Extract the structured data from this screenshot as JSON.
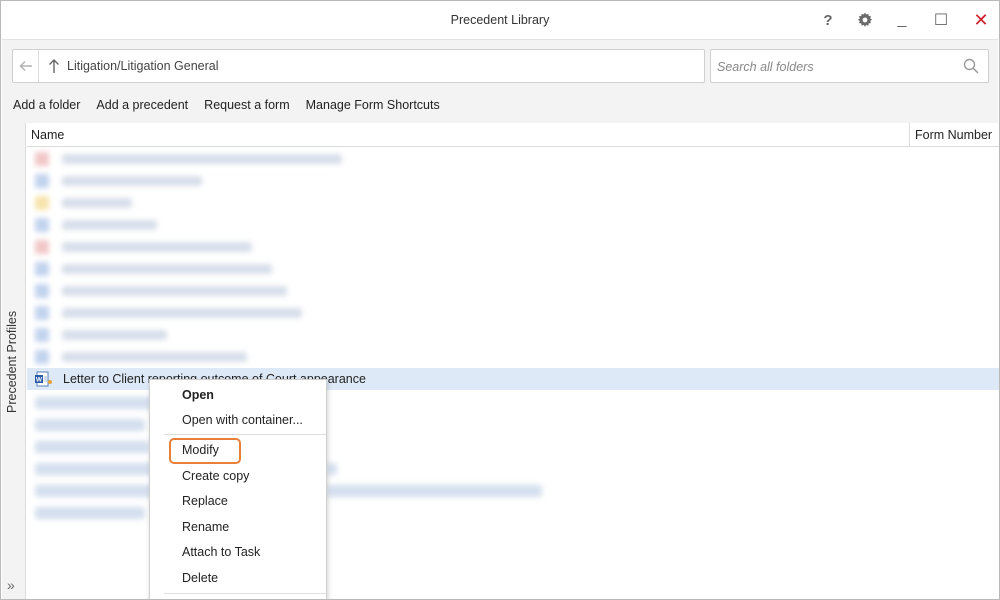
{
  "window": {
    "title": "Precedent Library",
    "controls": {
      "help": "?",
      "minimize": "_",
      "maximize": "☐",
      "close": "✕"
    }
  },
  "navigation": {
    "path": "Litigation/Litigation General",
    "search_placeholder": "Search all folders"
  },
  "actions": [
    "Add a folder",
    "Add a precedent",
    "Request a form",
    "Manage Form Shortcuts"
  ],
  "side_panel": {
    "label": "Precedent Profiles"
  },
  "list": {
    "columns": {
      "name": "Name",
      "form_number": "Form Number"
    },
    "selected_item": "Letter to Client reporting outcome of Court appearance"
  },
  "context_menu": {
    "items": [
      "Open",
      "Open with container...",
      "Modify",
      "Create copy",
      "Replace",
      "Rename",
      "Attach to Task",
      "Delete"
    ],
    "highlighted": "Modify"
  },
  "colors": {
    "selection": "#dde9f7",
    "highlight_border": "#e9803a",
    "close": "#d0202a"
  }
}
